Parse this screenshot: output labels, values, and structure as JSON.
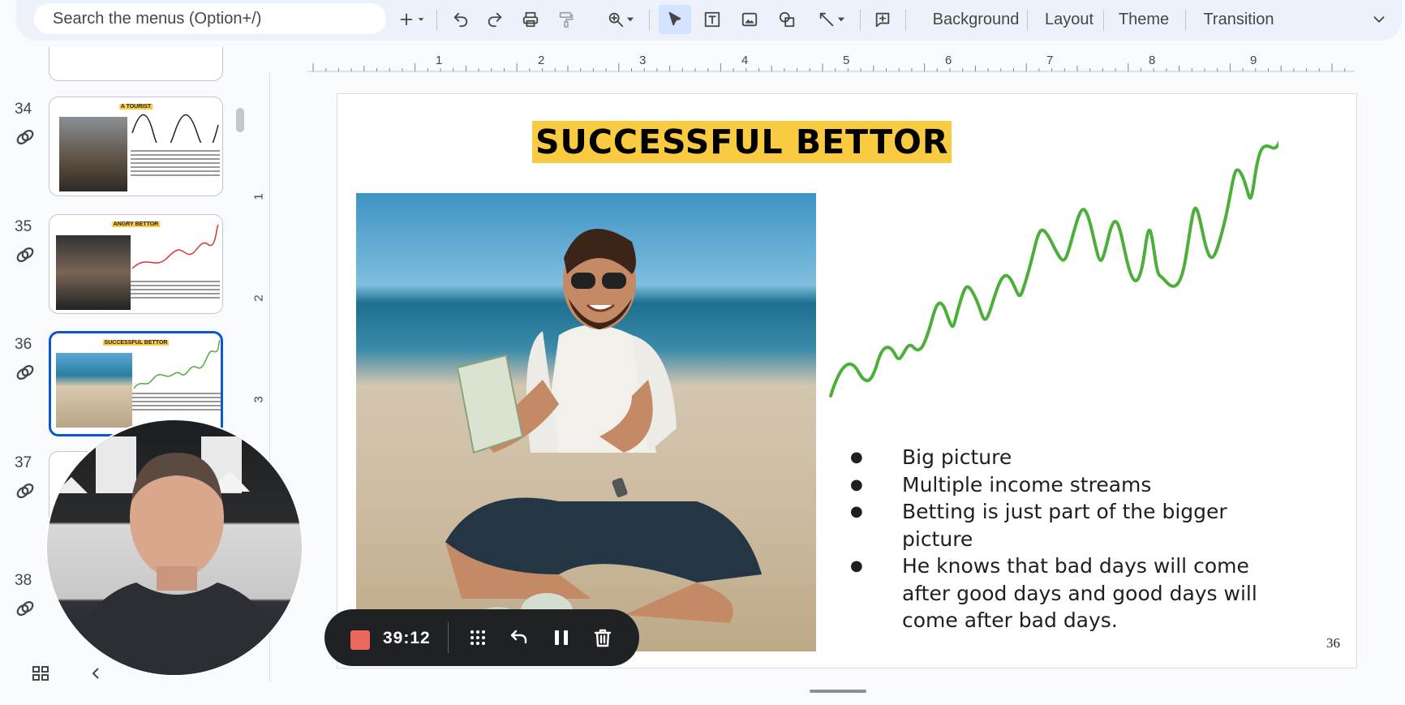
{
  "toolbar": {
    "search_placeholder": "Search the menus (Option+/)",
    "icons": [
      "new-slide-icon",
      "undo-icon",
      "redo-icon",
      "print-icon",
      "paint-format-icon",
      "zoom-icon",
      "select-icon",
      "textbox-icon",
      "image-icon",
      "shape-icon",
      "line-icon",
      "comment-icon"
    ],
    "background": "Background",
    "layout": "Layout",
    "theme": "Theme",
    "transition": "Transition"
  },
  "filmstrip": [
    {
      "num": "34",
      "title": "A TOURIST"
    },
    {
      "num": "35",
      "title": "ANGRY BETTOR"
    },
    {
      "num": "36",
      "title": "SUCCESSFUL BETTOR",
      "selected": true
    },
    {
      "num": "37",
      "title": ""
    },
    {
      "num": "38",
      "title": ""
    }
  ],
  "ruler": {
    "h": [
      "1",
      "2",
      "3",
      "4",
      "5",
      "6",
      "7",
      "8",
      "9"
    ],
    "v": [
      "1",
      "2",
      "3"
    ]
  },
  "slide": {
    "title": "SUCCESSFUL BETTOR",
    "bullets": [
      "Big picture",
      "Multiple income streams",
      "Betting is just part of the bigger picture",
      "He knows that bad days will come after good days and good days will come after bad days."
    ],
    "page_number": "36",
    "accent": "#f9cb40",
    "line_color": "#4caf3a"
  },
  "recorder": {
    "time": "39:12",
    "stop_color": "#ee675c"
  }
}
